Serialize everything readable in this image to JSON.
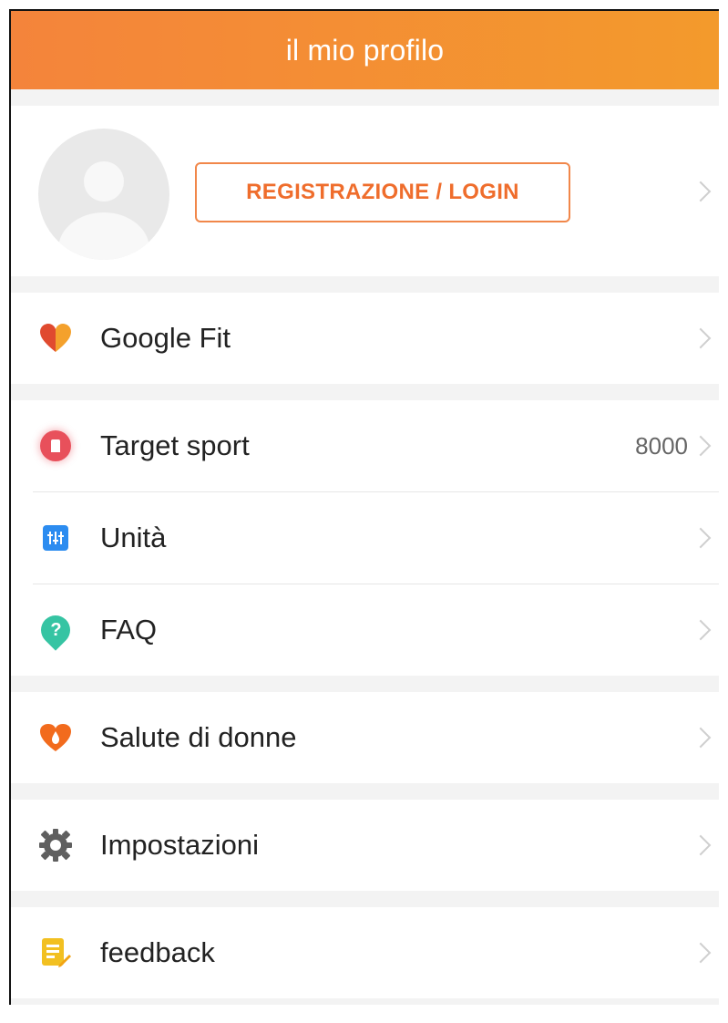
{
  "header": {
    "title": "il mio profilo"
  },
  "profile": {
    "login_label": "REGISTRAZIONE / LOGIN"
  },
  "menu": {
    "google_fit": {
      "label": "Google Fit"
    },
    "target_sport": {
      "label": "Target sport",
      "value": "8000"
    },
    "units": {
      "label": "Unità"
    },
    "faq": {
      "label": "FAQ"
    },
    "women_health": {
      "label": "Salute di donne"
    },
    "settings": {
      "label": "Impostazioni"
    },
    "feedback": {
      "label": "feedback"
    }
  },
  "colors": {
    "header_start": "#f4843b",
    "header_end": "#f39a2c",
    "accent": "#ef6d2c"
  },
  "icons": {
    "google_fit": "heart-icon",
    "target_sport": "target-icon",
    "units": "units-icon",
    "faq": "question-icon",
    "women_health": "drop-heart-icon",
    "settings": "gear-icon",
    "feedback": "note-icon"
  }
}
